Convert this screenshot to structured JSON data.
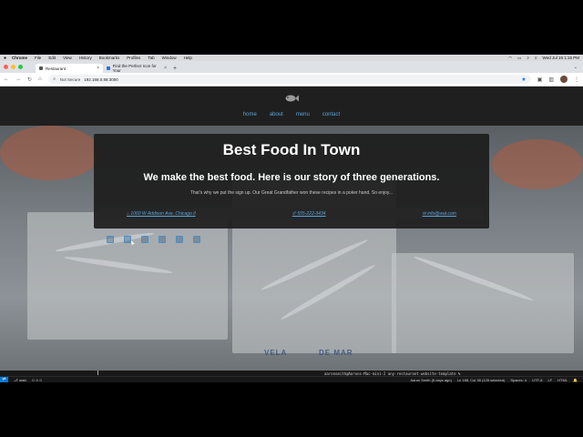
{
  "macos_menubar": {
    "items": [
      "Chrome",
      "File",
      "Edit",
      "View",
      "History",
      "Bookmarks",
      "Profiles",
      "Tab",
      "Window",
      "Help"
    ],
    "clock": "Wed Jul 19  1:15 PM"
  },
  "browser": {
    "tabs": [
      {
        "label": "Restaurant",
        "active": true
      },
      {
        "label": "Find the Perfect Icon for Your",
        "active": false
      }
    ],
    "security_label": "Not Secure",
    "url": "192.168.0.88:3000"
  },
  "site": {
    "nav": [
      "home",
      "about",
      "menu",
      "contact"
    ],
    "hero": {
      "title": "Best Food In Town",
      "subtitle": "We make the best food. Here is our story of three generations.",
      "tagline": "That's why we put the sign up. Our Great Grandfather won these recipes in a poker hand. So enjoy..."
    },
    "contact": {
      "address": "1060 W Addison Ave, Chicago Il",
      "phone": "555-222-3434",
      "email": "info@wat.com"
    },
    "crate_labels": [
      "VELA",
      "DE MAR"
    ],
    "icons": [
      "square-icon",
      "calculator-icon",
      "camera-icon",
      "instagram-icon",
      "sitemap-icon",
      "list-icon"
    ]
  },
  "vscode": {
    "terminal_text": "aaronsmith@Aarons-Mac-mini-2 any-restaurant-website-template %",
    "status": {
      "branch": "main",
      "problems": "0 ⚠ 0",
      "blame": "Aaron Smith (6 days ago)",
      "cursor": "Ln 188, Col 38 (128 selected)",
      "spaces": "Spaces: 4",
      "encoding": "UTF-8",
      "eol": "LF",
      "language": "HTML"
    }
  },
  "colors": {
    "link": "#5ba3d9",
    "header_bg": "#1f1f1f",
    "hero_bg": "#1c1c1c",
    "vscode_accent": "#0078d4"
  }
}
